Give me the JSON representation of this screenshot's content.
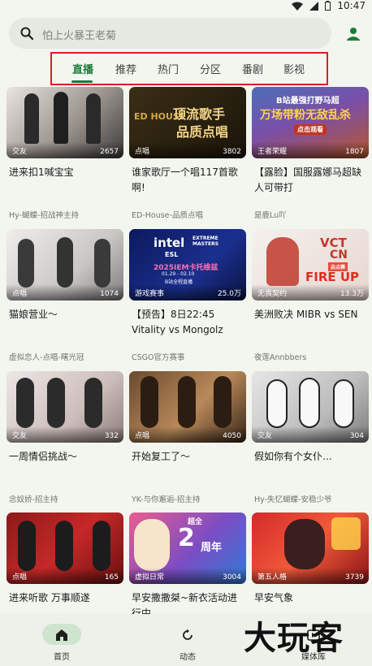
{
  "status": {
    "time": "10:47"
  },
  "search": {
    "placeholder": "怕上火暴王老菊"
  },
  "tabs": [
    {
      "label": "直播",
      "active": true
    },
    {
      "label": "推荐"
    },
    {
      "label": "热门"
    },
    {
      "label": "分区"
    },
    {
      "label": "番剧"
    },
    {
      "label": "影视"
    }
  ],
  "cards": [
    {
      "category": "交友",
      "count": "2657",
      "title": "进来扣1喊宝宝",
      "author": "Hy-蝴蝶-招战神主持"
    },
    {
      "category": "点唱",
      "count": "3802",
      "title": "谁家歌厅一个唱117首歌啊!",
      "author": "ED-House-品质点唱",
      "thumb_text": [
        "顶流歌手",
        "品质点唱"
      ],
      "thumb_logo": "ED HOUSE"
    },
    {
      "category": "王者荣耀",
      "count": "1807",
      "title": "【露脸】国服露娜马超缺人可带打",
      "author": "是鹿Lu吖",
      "thumb_text": [
        "B站最强打野马超",
        "万场带粉无敌乱杀",
        "点击观看"
      ]
    },
    {
      "category": "点唱",
      "count": "1074",
      "title": "猫娘营业～",
      "author": "虚拟恋人-点唱-曙光冠"
    },
    {
      "category": "游戏赛事",
      "count": "25.0万",
      "title": "【预告】8日22:45 Vitality vs Mongolz",
      "author": "CSGO官方赛事",
      "thumb_text": [
        "intel",
        "EXTREME MASTERS",
        "ESL",
        "2025IEM卡托维兹",
        "01.29 - 02.10",
        "B站全程直播"
      ]
    },
    {
      "category": "无畏契约",
      "count": "13.3万",
      "title": "美洲败决 MIBR vs SEN",
      "author": "夜莲Annbbers",
      "thumb_text": [
        "VCT",
        "CN",
        "启点赛",
        "FIRE UP"
      ]
    },
    {
      "category": "交友",
      "count": "332",
      "title": "一周情侣挑战～",
      "author": "念奴娇-招主持"
    },
    {
      "category": "点唱",
      "count": "4050",
      "title": "开始复工了～",
      "author": "YK-与你邂逅-招主持"
    },
    {
      "category": "交友",
      "count": "304",
      "title": "假如你有个女仆…",
      "author": "Hy-失忆蝴蝶-安稳少爷"
    },
    {
      "category": "点唱",
      "count": "165",
      "title": "进来听歌 万事顺遂",
      "author": ""
    },
    {
      "category": "虚拟日常",
      "count": "3004",
      "title": "早安撒撒桀~新衣活动进行中",
      "author": "",
      "thumb_text": [
        "2",
        "周年",
        "超全"
      ]
    },
    {
      "category": "第五人格",
      "count": "3739",
      "title": "早安气象",
      "author": ""
    }
  ],
  "bottom_nav": [
    {
      "label": "首页",
      "icon": "home-icon",
      "active": true
    },
    {
      "label": "动态",
      "icon": "refresh-icon"
    },
    {
      "label": "媒体库",
      "icon": "library-icon"
    }
  ],
  "watermark": "大玩客",
  "colors": {
    "accent": "#1f7a3b",
    "highlight_box": "#d61f27",
    "background": "#f3f5ef"
  }
}
